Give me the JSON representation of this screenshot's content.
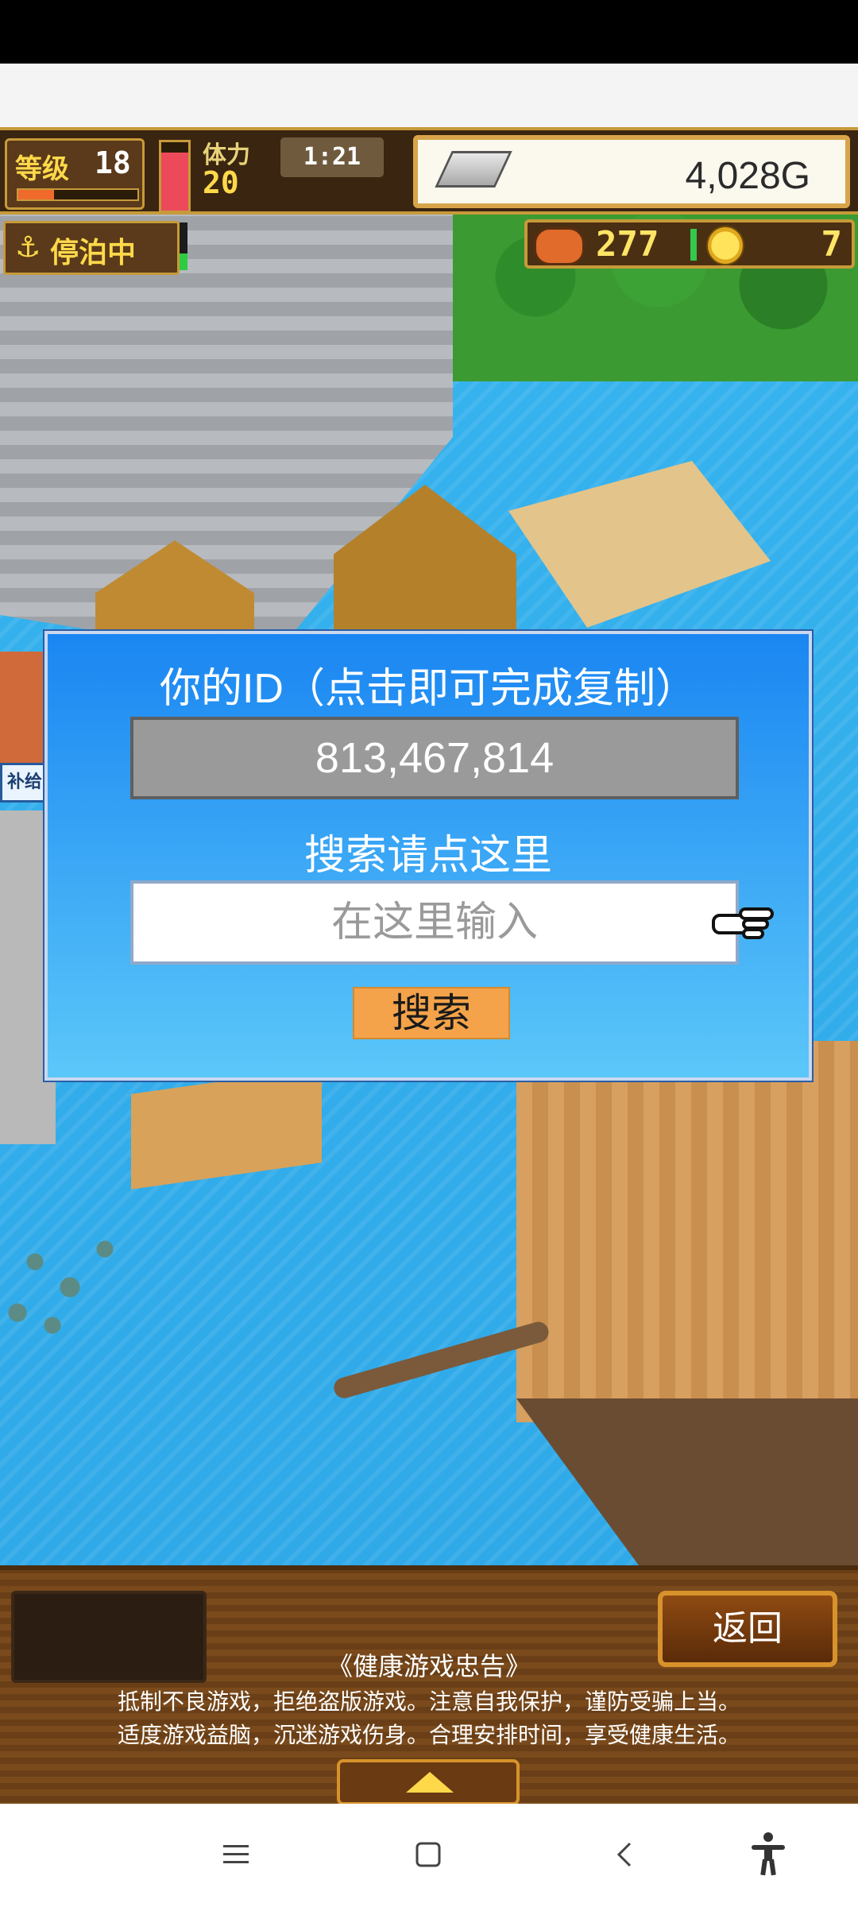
{
  "hud": {
    "level_label": "等级",
    "level": "18",
    "exp_progress": 0.3,
    "stamina_label": "体力",
    "stamina": "20",
    "stamina_bar_fraction": 0.85,
    "timer": "1:21",
    "gold": "4,028G",
    "status_badge": "停泊中",
    "status_meter_fraction": 0.35,
    "food": "277",
    "coins": "7"
  },
  "map": {
    "resupply_tag": "补给"
  },
  "dialog": {
    "title": "你的ID（点击即可完成复制）",
    "user_id": "813,467,814",
    "search_hint": "搜索请点这里",
    "input_placeholder": "在这里输入",
    "search_button": "搜索"
  },
  "bottom": {
    "return_button": "返回",
    "health_title": "《健康游戏忠告》",
    "health_line1": "抵制不良游戏，拒绝盗版游戏。注意自我保护，谨防受骗上当。",
    "health_line2": "适度游戏益脑，沉迷游戏伤身。合理安排时间，享受健康生活。"
  },
  "icons": {
    "anchor": "anchor-icon",
    "silver": "silver-ingot-icon",
    "food": "food-icon",
    "coin": "coin-icon",
    "pointer": "hand-pointer-icon"
  },
  "colors": {
    "dialog_top": "#1a86f2",
    "dialog_bottom": "#5bc7f9",
    "search_button": "#f4a34a",
    "hud_gold_text": "#ffd94a"
  }
}
